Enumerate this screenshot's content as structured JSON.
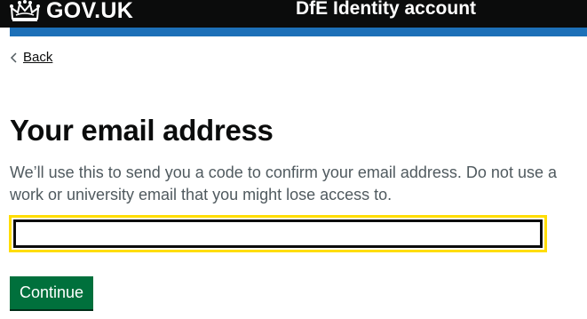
{
  "header": {
    "logo_text": "GOV.UK",
    "service_name": "DfE Identity account",
    "crown_icon": "crown-icon",
    "accent_color": "#1d70b8"
  },
  "back": {
    "label": "Back",
    "icon": "chevron-left-icon"
  },
  "main": {
    "title": "Your email address",
    "hint": "We’ll use this to send you a code to confirm your email address. Do not use a work or university email that you might lose access to.",
    "email_value": "",
    "continue_label": "Continue",
    "button_color": "#00703c",
    "focus_color": "#ffdd00"
  }
}
